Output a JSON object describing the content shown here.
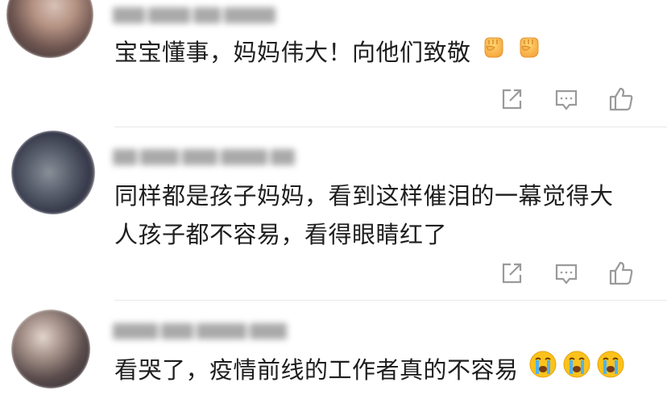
{
  "comments": [
    {
      "text": "宝宝懂事，妈妈伟大！向他们致敬",
      "emoji": [
        "fist-emoji",
        "fist-emoji"
      ],
      "avatar_colors": [
        "#c9b2a7",
        "#8a6d61",
        "#3f3436"
      ]
    },
    {
      "lines": [
        "同样都是孩子妈妈，看到这样催泪的一幕觉得大",
        "人孩子都不容易，看得眼睛红了"
      ],
      "avatar_colors": [
        "#6f7a86",
        "#3e4656",
        "#b9a99c"
      ]
    },
    {
      "text": "看哭了，疫情前线的工作者真的不容易",
      "emoji": [
        "crying-face-emoji",
        "crying-face-emoji",
        "crying-face-emoji"
      ],
      "avatar_colors": [
        "#d7c7be",
        "#6c5e5a",
        "#2d2a2f"
      ]
    }
  ],
  "actions": {
    "icons": [
      "share-icon",
      "reply-icon",
      "like-icon"
    ],
    "icon_color": "#9a9a9a"
  }
}
